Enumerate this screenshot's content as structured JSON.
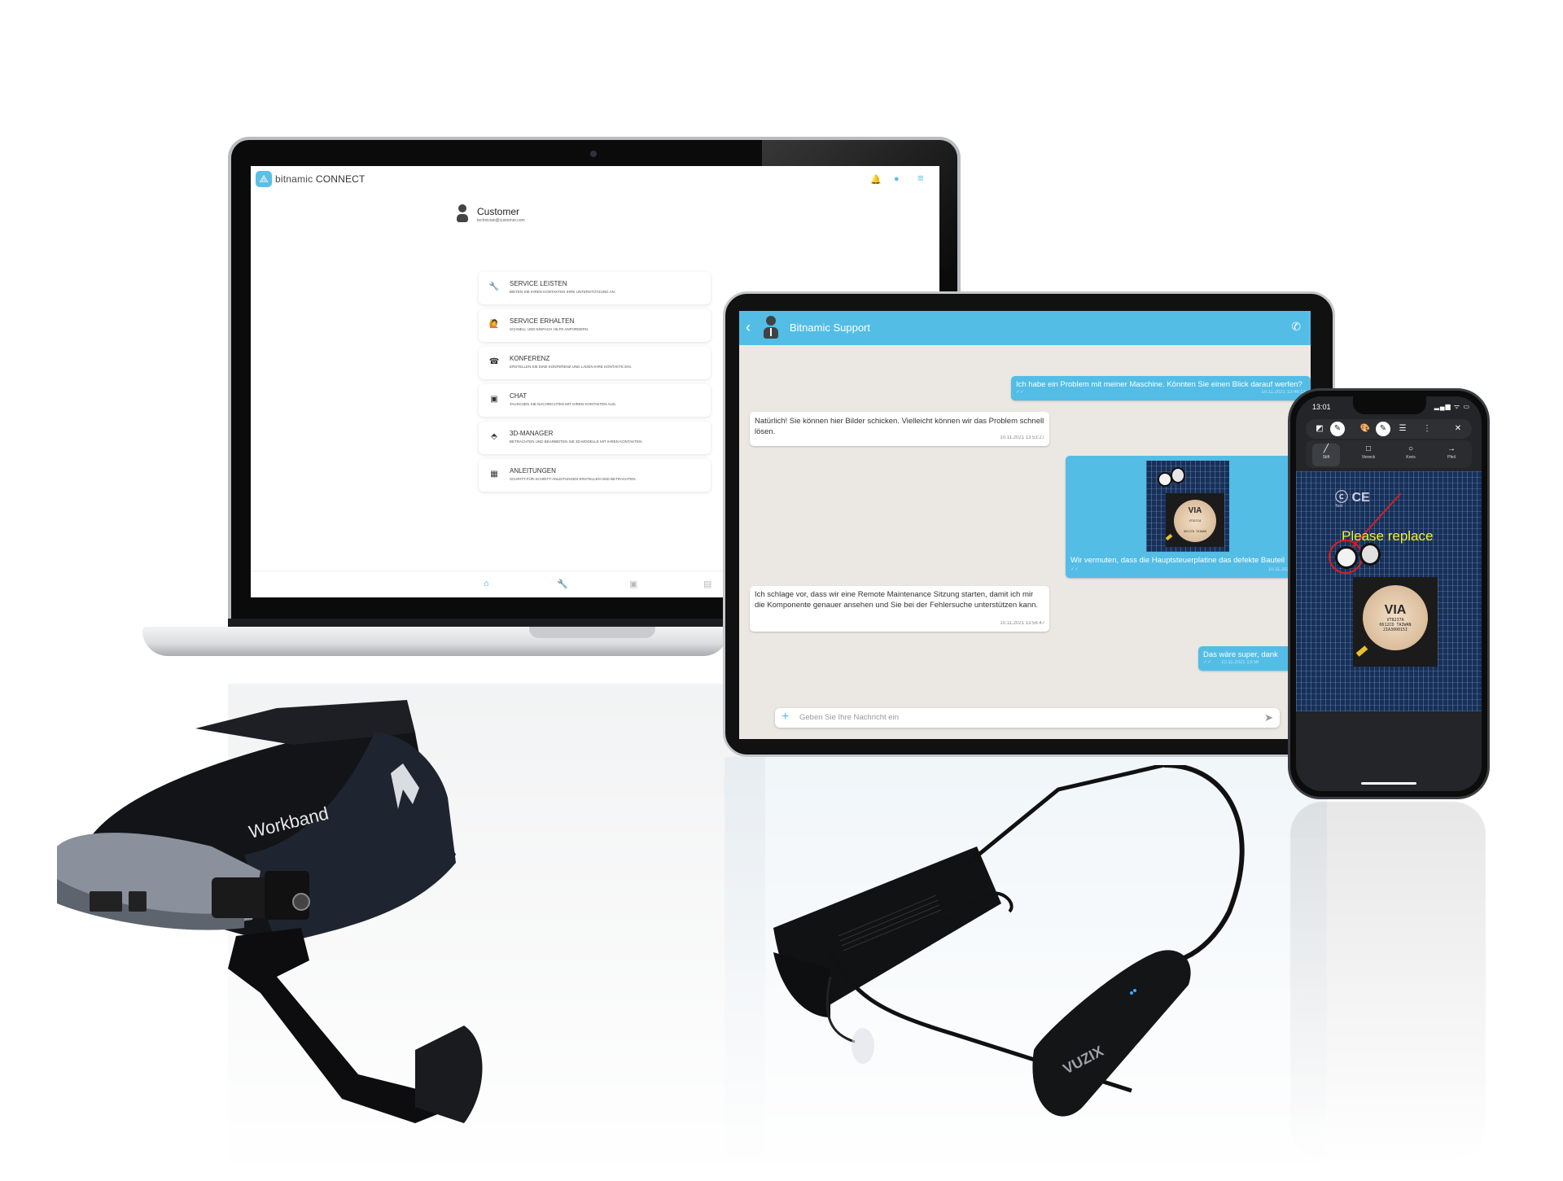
{
  "scene": {
    "description": "Product composition: laptop, tablet and smartphone running bitnamic CONNECT, plus two smart glasses",
    "colors": {
      "brand_blue": "#53bde6",
      "nav_active": "#3aa6e0",
      "annotation_yellow": "#f2ee2a",
      "annotation_red": "#e01b1b",
      "pcb_blue": "#16305a"
    }
  },
  "laptop": {
    "app": {
      "logo_icon": "bitnamic-logo-icon",
      "name_prefix": "bitnamic",
      "name_suffix": "CONNECT",
      "top_icons": [
        {
          "name": "notification-bell-icon",
          "glyph": "🔔"
        },
        {
          "name": "status-dot-icon",
          "glyph": "●"
        },
        {
          "name": "hamburger-menu-icon",
          "glyph": "≡"
        }
      ]
    },
    "profile": {
      "name": "Customer",
      "email": "technician@customer.com"
    },
    "menu": [
      {
        "icon": "wrench-icon",
        "glyph": "🔧",
        "title": "SERVICE LEISTEN",
        "desc": "BIETEN SIE IHREN KONTAKTEN IHRE UNTERSTÜTZUNG AN."
      },
      {
        "icon": "person-raising-hand-icon",
        "glyph": "🙋",
        "title": "SERVICE ERHALTEN",
        "desc": "SCHNELL UND EINFACH HILFE ANFORDERN."
      },
      {
        "icon": "conference-call-icon",
        "glyph": "☎",
        "title": "KONFERENZ",
        "desc": "ERSTELLEN SIE EINE KONFERENZ UND LADEN IHRE KONTAKTE EIN."
      },
      {
        "icon": "chat-bubble-icon",
        "glyph": "▣",
        "title": "CHAT",
        "desc": "TAUSCHEN SIE NACHRICHTEN MIT IHREN KONTAKTEN AUS."
      },
      {
        "icon": "3d-model-icon",
        "glyph": "⬘",
        "title": "3D-MANAGER",
        "desc": "BETRACHTEN UND BEARBEITEN SIE 3D-MODELLE MIT IHREN KONTAKTEN."
      },
      {
        "icon": "grid-instructions-icon",
        "glyph": "▦",
        "title": "ANLEITUNGEN",
        "desc": "SCHRITT-FÜR-SCHRITT-ANLEITUNGEN ERSTELLEN UND BETRACHTEN."
      }
    ],
    "bottom_nav": [
      {
        "name": "nav-home",
        "icon": "home-icon",
        "glyph": "⌂",
        "active": true
      },
      {
        "name": "nav-service",
        "icon": "wrench-icon",
        "glyph": "🔧",
        "active": false
      },
      {
        "name": "nav-chat",
        "icon": "chat-bubble-icon",
        "glyph": "▣",
        "active": false
      },
      {
        "name": "nav-contacts",
        "icon": "contacts-icon",
        "glyph": "▤",
        "active": false
      }
    ]
  },
  "tablet": {
    "header": {
      "back_glyph": "‹",
      "title": "Bitnamic Support",
      "call_glyph": "✆"
    },
    "messages": [
      {
        "dir": "out",
        "text": "Ich habe ein Problem mit meiner Maschine. Könnten Sie einen Blick darauf werfen?",
        "time": "10.11.2021 13:46:13",
        "check": "✓✓"
      },
      {
        "dir": "in",
        "text": "Natürlich! Sie können hier Bilder schicken. Vielleicht können wir das Problem schnell lösen.",
        "time": "10.11.2021 13:53:27"
      },
      {
        "dir": "out",
        "text": "Wir vermuten, dass die Hauptsteuerplatine das defekte Bauteil",
        "time": "10.11.2021 13:55",
        "check": "✓✓",
        "has_image": true
      },
      {
        "dir": "in",
        "text": "Ich schlage vor, dass wir eine Remote Maintenance Sitzung starten, damit ich mir die Komponente genauer ansehen und Sie bei der Fehlersuche unterstützen kann.",
        "time": "10.11.2021 13:56:47"
      },
      {
        "dir": "out",
        "text": "Das wäre super, dank",
        "time": "10.11.2021 13:56",
        "check": "✓✓"
      }
    ],
    "input": {
      "plus_glyph": "+",
      "placeholder": "Geben Sie Ihre Nachricht ein",
      "send_glyph": "➤"
    },
    "chip": {
      "brand": "VIA",
      "line1": "VT8237A",
      "line2": "0612CD TAIWAN",
      "line3": "2IA300015I"
    }
  },
  "phone": {
    "status": {
      "time": "13:01",
      "icons": "▂▄▆ ᯤ ▭"
    },
    "toolbar": [
      {
        "name": "image-adjust-icon",
        "glyph": "◩",
        "style": "plain"
      },
      {
        "name": "pen-tool-icon",
        "glyph": "✎",
        "style": "circle"
      },
      {
        "name": "color-palette-icon",
        "glyph": "🎨",
        "style": "plain"
      },
      {
        "name": "brush-tool-icon",
        "glyph": "✎",
        "style": "circle"
      },
      {
        "name": "line-weight-icon",
        "glyph": "☰",
        "style": "plain"
      },
      {
        "name": "more-options-icon",
        "glyph": "⋮",
        "style": "plain"
      },
      {
        "name": "close-icon",
        "glyph": "✕",
        "style": "plain"
      }
    ],
    "shapes": [
      {
        "name": "pen-shape",
        "glyph": "╱",
        "label": "Stift",
        "selected": true
      },
      {
        "name": "rectangle-shape",
        "glyph": "□",
        "label": "Viereck",
        "selected": false
      },
      {
        "name": "circle-shape",
        "glyph": "○",
        "label": "Kreis",
        "selected": false
      },
      {
        "name": "arrow-shape",
        "glyph": "→",
        "label": "Pfeil",
        "selected": false
      }
    ],
    "annotation": {
      "text": "Please replace",
      "label_text": "Text"
    },
    "chip": {
      "brand": "VIA",
      "line1": "VT8237A",
      "line2": "0612CD TAIWAN",
      "line3": "2IA300015I"
    }
  },
  "devices": {
    "workband": {
      "label": "Workband"
    },
    "vuzix": {
      "label": "VUZIX"
    }
  }
}
